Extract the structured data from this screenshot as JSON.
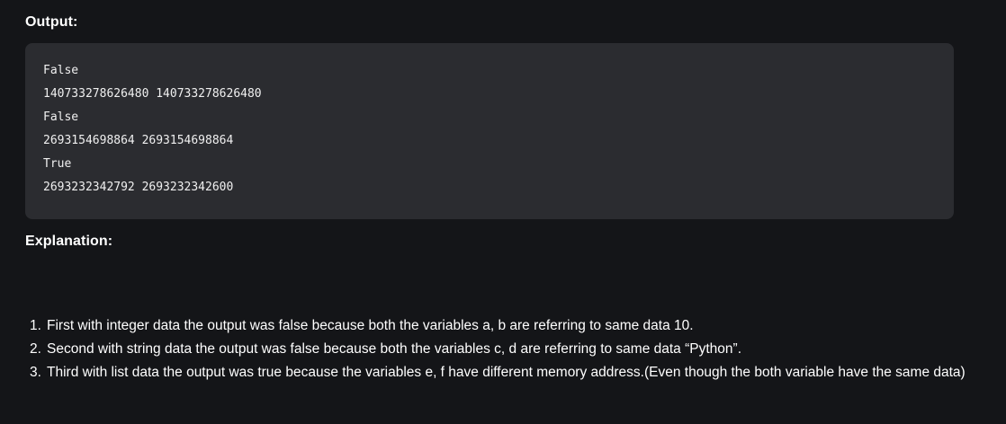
{
  "output_heading": "Output:",
  "output_lines": [
    "False",
    "140733278626480 140733278626480",
    "False",
    "2693154698864 2693154698864",
    "True",
    "2693232342792 2693232342600"
  ],
  "explanation_heading": "Explanation:",
  "explanation_items": [
    {
      "number": "1.",
      "text": "First with integer data the output was false because both the variables a, b are referring to same data 10."
    },
    {
      "number": "2.",
      "text": "Second with string data the output was false because both the variables c, d are referring to same data “Python”."
    },
    {
      "number": "3.",
      "text": "Third with list data the output was true because the variables e, f have different memory address.(Even though the both variable have the same data)"
    }
  ],
  "colors": {
    "page_background": "#141518",
    "code_background": "#2b2c30",
    "text": "#ffffff"
  }
}
